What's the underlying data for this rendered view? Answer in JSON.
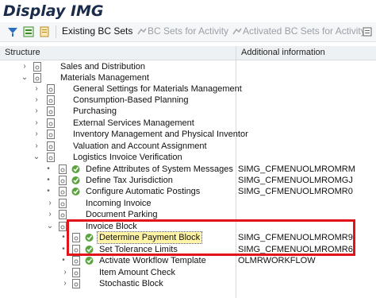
{
  "window": {
    "title": "Display IMG"
  },
  "toolbar": {
    "existing_bc_sets": "Existing BC Sets",
    "bc_sets_for_activity": "BC Sets for Activity",
    "activated_bc_sets_for_activity": "Activated BC Sets for Activity",
    "icons": [
      "find-icon",
      "display-icon",
      "bookmark-icon",
      "bc-set-icon",
      "bc-set-icon",
      "more-icon"
    ]
  },
  "header": {
    "structure": "Structure",
    "additional_information": "Additional information"
  },
  "tree": {
    "rows": [
      {
        "label": "Sales and Distribution",
        "addl": ""
      },
      {
        "label": "Materials Management",
        "addl": ""
      },
      {
        "label": "General Settings for Materials Management",
        "addl": ""
      },
      {
        "label": "Consumption-Based Planning",
        "addl": ""
      },
      {
        "label": "Purchasing",
        "addl": ""
      },
      {
        "label": "External Services Management",
        "addl": ""
      },
      {
        "label": "Inventory Management and Physical Inventor",
        "addl": ""
      },
      {
        "label": "Valuation and Account Assignment",
        "addl": ""
      },
      {
        "label": "Logistics Invoice Verification",
        "addl": ""
      },
      {
        "label": "Define Attributes of System Messages",
        "addl": "SIMG_CFMENUOLMROMRM"
      },
      {
        "label": "Define Tax Jurisdiction",
        "addl": "SIMG_CFMENUOLMROMGJ"
      },
      {
        "label": "Configure Automatic Postings",
        "addl": "SIMG_CFMENUOLMROMR0"
      },
      {
        "label": "Incoming Invoice",
        "addl": ""
      },
      {
        "label": "Document Parking",
        "addl": ""
      },
      {
        "label": "Invoice Block",
        "addl": ""
      },
      {
        "label": "Determine Payment Block",
        "addl": "SIMG_CFMENUOLMROMR9"
      },
      {
        "label": "Set Tolerance Limits",
        "addl": "SIMG_CFMENUOLMROMR6"
      },
      {
        "label": "Activate Workflow Template",
        "addl": "OLMRWORKFLOW"
      },
      {
        "label": "Item Amount Check",
        "addl": ""
      },
      {
        "label": "Stochastic Block",
        "addl": ""
      }
    ]
  },
  "colors": {
    "highlight": "#e2131b",
    "selection": "#fff3a6"
  }
}
